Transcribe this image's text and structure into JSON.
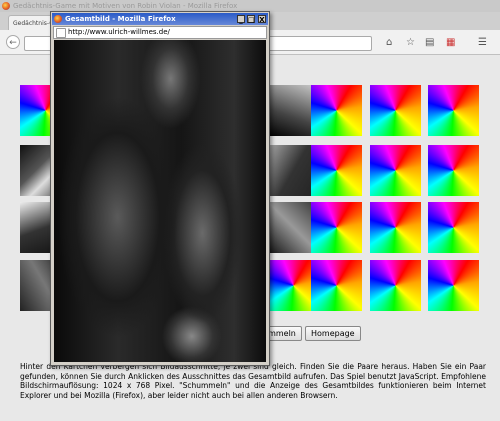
{
  "main_window": {
    "title": "Gedächtnis-Game mit Motiven von Robin Violan - Mozilla Firefox"
  },
  "tab": {
    "label": "Gedächtnis-G"
  },
  "popup": {
    "title": "Gesamtbild - Mozilla Firefox",
    "url": "http://www.ulrich-willmes.de/",
    "buttons": {
      "minimize": "_",
      "maximize": "□",
      "close": "X"
    }
  },
  "page": {
    "shuffle_label": "ummeln",
    "homepage_label": "Homepage",
    "description": "Hinter den Kärtchen verbergen sich Bildausschnitte, je zwei sind gleich. Finden Sie die Paare heraus. Haben Sie ein Paar gefunden, können Sie durch Anklicken des Ausschnittes das Gesamtbild aufrufen. Das Spiel benutzt JavaScript. Empfohlene Bildschirmauflösung: 1024 x 768 Pixel. \"Schummeln\" und die Anzeige des Gesamtbildes funktionieren beim Internet Explorer und bei Mozilla (Firefox), aber leider nicht auch bei allen anderen Browsern."
  },
  "icons": [
    "firefox-icon",
    "back-icon",
    "home-icon",
    "bookmark-star-icon",
    "bookmarks-list-icon",
    "addon-icon",
    "menu-icon",
    "page-icon"
  ]
}
